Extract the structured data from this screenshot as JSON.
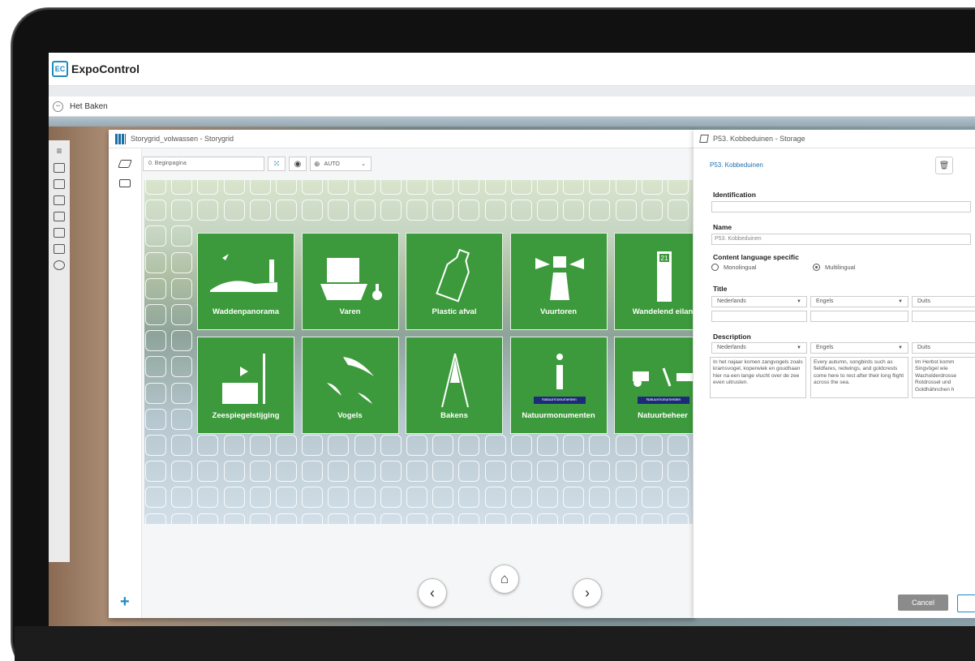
{
  "app": {
    "name": "ExpoControl",
    "logo_text": "EC",
    "brand_color": "#1e8bc3"
  },
  "context": {
    "label": "Het Baken"
  },
  "storygrid": {
    "title": "Storygrid_volwassen - Storygrid",
    "page_value": "0. Beginpagina",
    "zoom_value": "AUTO",
    "tiles": [
      {
        "label": "Waddenpanorama",
        "icon": "coast-lighthouse-icon"
      },
      {
        "label": "Varen",
        "icon": "ship-icon"
      },
      {
        "label": "Plastic afval",
        "icon": "bottle-icon"
      },
      {
        "label": "Vuurtoren",
        "icon": "lighthouse-icon"
      },
      {
        "label": "Wandelend eilan",
        "icon": "signpost-icon",
        "badge": "21"
      },
      {
        "label": "Zeespiegelstijging",
        "icon": "sea-level-icon"
      },
      {
        "label": "Vogels",
        "icon": "birds-icon"
      },
      {
        "label": "Bakens",
        "icon": "beacon-icon"
      },
      {
        "label": "Natuurmonumenten",
        "icon": "info-icon",
        "sub": "Natuurmonumenten"
      },
      {
        "label": "Natuurbeheer",
        "icon": "farm-icon",
        "sub": "Natuurmonumenten"
      }
    ],
    "tile_color": "#3c9a3c"
  },
  "storage": {
    "title": "P53. Kobbeduinen - Storage",
    "breadcrumb": "P53. Kobbeduinen",
    "identification_label": "Identification",
    "identification_value": "",
    "name_label": "Name",
    "name_value": "P53. Kobbeduinen",
    "language_label": "Content language specific",
    "radio_mono": "Monolingual",
    "radio_multi": "Multilingual",
    "radio_selected": "Multilingual",
    "title_label": "Title",
    "description_label": "Description",
    "languages": [
      "Nederlands",
      "Engels",
      "Duits"
    ],
    "descriptions": [
      "In het najaar komen zangvogels zoals kramsvogel, koperwiek en goudhaan hier na een lange vlucht over de zee even uitrusten.",
      "Every autumn, songbirds such as fieldfares, redwings, and goldcrests come here to rest after their long flight across the sea.",
      "Im Herbst komm Singvögel wie Wacholderdrosse Rotdrossel und Goldhähnchen h"
    ],
    "cancel_label": "Cancel"
  }
}
